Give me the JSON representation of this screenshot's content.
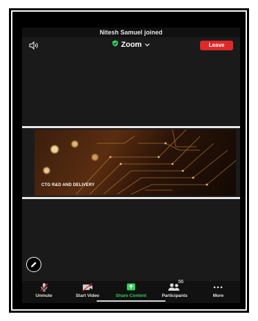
{
  "notification": "Nitesh Samuel joined",
  "header": {
    "speaker_icon": "speaker-icon",
    "title": "Zoom",
    "shield_icon": "shield-icon",
    "chevron_icon": "chevron-down-icon",
    "leave_label": "Leave",
    "leave_color": "#e02828"
  },
  "share": {
    "caption": "CTG R&D AND DELIVERY"
  },
  "annotate_icon": "pencil-icon",
  "toolbar": {
    "items": [
      {
        "label": "Unmute",
        "icon": "muted-mic-icon"
      },
      {
        "label": "Start Video",
        "icon": "video-off-icon"
      },
      {
        "label": "Share Content",
        "icon": "share-arrow-icon",
        "color": "#2fd05b"
      },
      {
        "label": "Participants",
        "icon": "participants-icon",
        "count": "56"
      },
      {
        "label": "More",
        "icon": "more-dots-icon"
      }
    ]
  }
}
